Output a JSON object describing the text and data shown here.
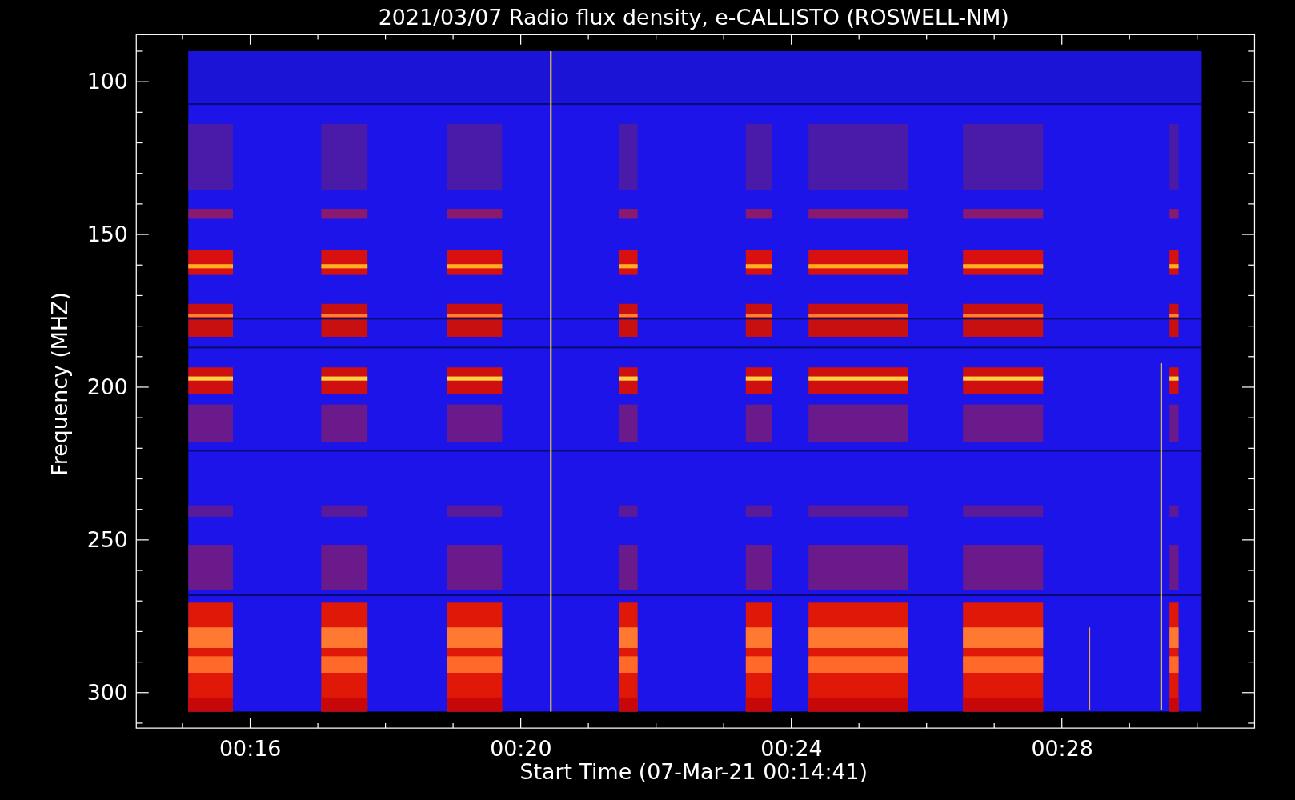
{
  "plot": {
    "title": "2021/03/07  Radio flux density, e-CALLISTO (ROSWELL-NM)",
    "ylabel": "Frequency (MHZ)",
    "xlabel": "Start Time (07-Mar-21 00:14:41)",
    "yticks": [
      "100",
      "150",
      "200",
      "250",
      "300"
    ],
    "xticks": [
      "00:16",
      "00:20",
      "00:24",
      "00:28"
    ]
  }
}
